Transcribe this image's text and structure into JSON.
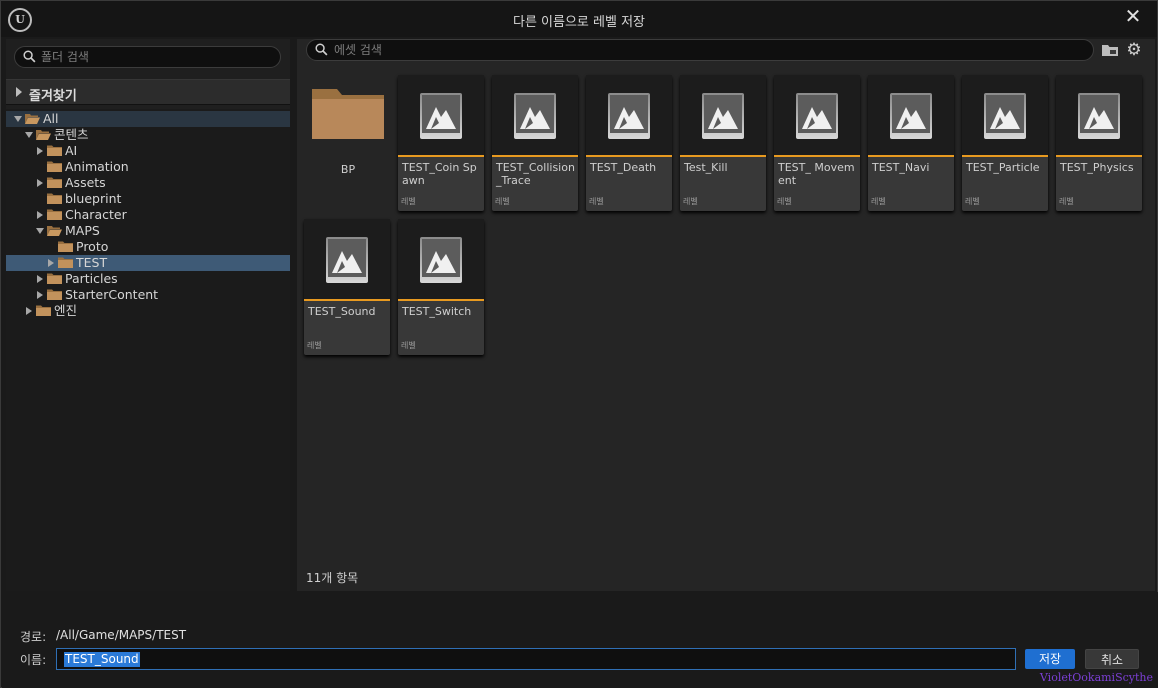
{
  "window": {
    "title": "다른 이름으로 레벨 저장",
    "logo_text": "U",
    "close_glyph": "✕"
  },
  "sidebar": {
    "search_placeholder": "폴더 검색",
    "favorites_label": "즐겨찾기",
    "tree": [
      {
        "label": "All",
        "depth": 0,
        "expanded": true,
        "has_children": true,
        "section": true
      },
      {
        "label": "콘텐츠",
        "depth": 1,
        "expanded": true,
        "has_children": true
      },
      {
        "label": "AI",
        "depth": 2,
        "expanded": false,
        "has_children": true
      },
      {
        "label": "Animation",
        "depth": 2,
        "expanded": false,
        "has_children": false
      },
      {
        "label": "Assets",
        "depth": 2,
        "expanded": false,
        "has_children": true
      },
      {
        "label": "blueprint",
        "depth": 2,
        "expanded": false,
        "has_children": false
      },
      {
        "label": "Character",
        "depth": 2,
        "expanded": false,
        "has_children": true
      },
      {
        "label": "MAPS",
        "depth": 2,
        "expanded": true,
        "has_children": true
      },
      {
        "label": "Proto",
        "depth": 3,
        "expanded": false,
        "has_children": false
      },
      {
        "label": "TEST",
        "depth": 3,
        "expanded": false,
        "has_children": true,
        "selected": true
      },
      {
        "label": "Particles",
        "depth": 2,
        "expanded": false,
        "has_children": true
      },
      {
        "label": "StarterContent",
        "depth": 2,
        "expanded": false,
        "has_children": true
      },
      {
        "label": "엔진",
        "depth": 1,
        "expanded": false,
        "has_children": true
      }
    ]
  },
  "assets": {
    "search_placeholder": "에셋 검색",
    "folder_tile": {
      "name": "BP"
    },
    "tiles": [
      {
        "name": "TEST_Coin Spawn",
        "type": "레벨"
      },
      {
        "name": "TEST_Collision _Trace",
        "type": "레벨"
      },
      {
        "name": "TEST_Death",
        "type": "레벨"
      },
      {
        "name": "Test_Kill",
        "type": "레벨"
      },
      {
        "name": "TEST_ Movement",
        "type": "레벨"
      },
      {
        "name": "TEST_Navi",
        "type": "레벨"
      },
      {
        "name": "TEST_Particle",
        "type": "레벨"
      },
      {
        "name": "TEST_Physics",
        "type": "레벨"
      },
      {
        "name": "TEST_Sound",
        "type": "레벨"
      },
      {
        "name": "TEST_Switch",
        "type": "레벨"
      }
    ],
    "item_count": "11개 항목"
  },
  "footer": {
    "path_label": "경로:",
    "path_value": "/All/Game/MAPS/TEST",
    "name_label": "이름:",
    "name_value": "TEST_Sound",
    "save_label": "저장",
    "cancel_label": "취소"
  },
  "watermark": "VioletOokamiScythe",
  "colors": {
    "accent": "#1f6fd1",
    "selection": "#3e5a76",
    "level_underline": "#e89a20",
    "folder": "#b8885a"
  }
}
